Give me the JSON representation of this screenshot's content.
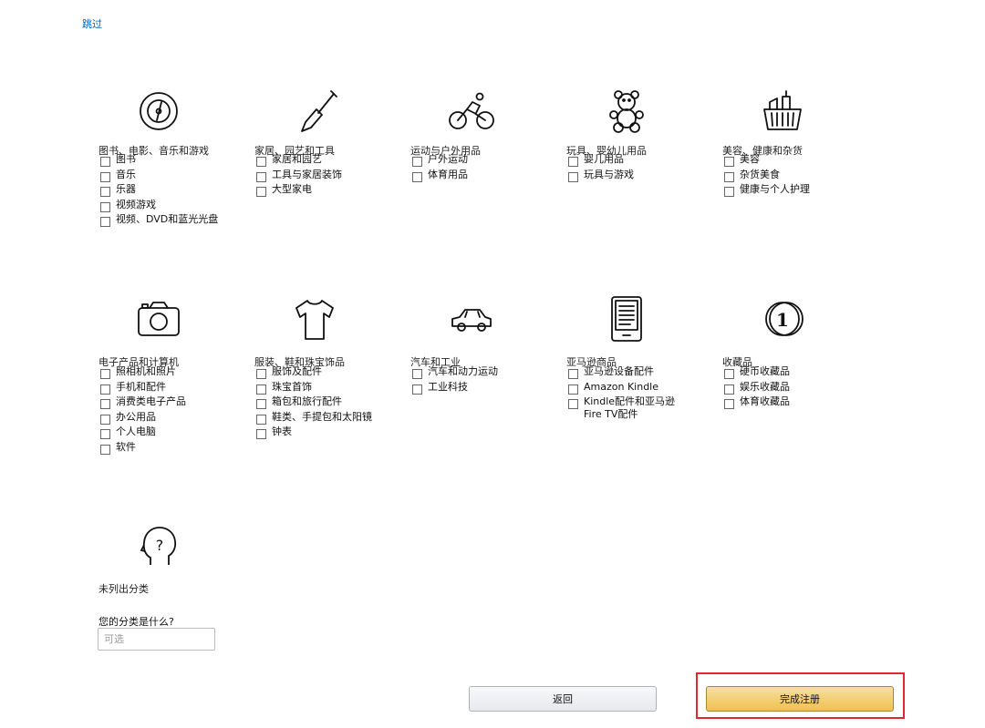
{
  "header": {
    "skip_label": "跳过"
  },
  "categories": [
    {
      "id": "books",
      "icon": "disc-icon",
      "title": "图书、电影、音乐和游戏",
      "options": [
        "图书",
        "音乐",
        "乐器",
        "视频游戏",
        "视频、DVD和蓝光光盘"
      ]
    },
    {
      "id": "home",
      "icon": "shovel-icon",
      "title": "家居、园艺和工具",
      "options": [
        "家居和园艺",
        "工具与家居装饰",
        "大型家电"
      ]
    },
    {
      "id": "sports",
      "icon": "cyclist-icon",
      "title": "运动与户外用品",
      "options": [
        "户外运动",
        "体育用品"
      ]
    },
    {
      "id": "toys",
      "icon": "teddy-bear-icon",
      "title": "玩具、婴幼儿用品",
      "options": [
        "婴儿用品",
        "玩具与游戏"
      ]
    },
    {
      "id": "beauty",
      "icon": "basket-icon",
      "title": "美容、健康和杂货",
      "options": [
        "美容",
        "杂货美食",
        "健康与个人护理"
      ]
    },
    {
      "id": "electronics",
      "icon": "camera-icon",
      "title": "电子产品和计算机",
      "options": [
        "照相机和照片",
        "手机和配件",
        "消费类电子产品",
        "办公用品",
        "个人电脑",
        "软件"
      ]
    },
    {
      "id": "fashion",
      "icon": "tshirt-icon",
      "title": "服装、鞋和珠宝饰品",
      "options": [
        "服饰及配件",
        "珠宝首饰",
        "箱包和旅行配件",
        "鞋类、手提包和太阳镜",
        "钟表"
      ]
    },
    {
      "id": "auto",
      "icon": "car-icon",
      "title": "汽车和工业",
      "options": [
        "汽车和动力运动",
        "工业科技"
      ]
    },
    {
      "id": "amazon",
      "icon": "ereader-icon",
      "title": "亚马逊商品",
      "options": [
        "亚马逊设备配件",
        "Amazon Kindle",
        "Kindle配件和亚马逊 Fire TV配件"
      ]
    },
    {
      "id": "collectibles",
      "icon": "coin-icon",
      "title": "收藏品",
      "options": [
        "硬币收藏品",
        "娱乐收藏品",
        "体育收藏品"
      ]
    }
  ],
  "unlisted": {
    "icon": "question-head-icon",
    "title": "未列出分类",
    "question": "您的分类是什么?",
    "input_placeholder": "可选",
    "input_value": ""
  },
  "actions": {
    "back_label": "返回",
    "finish_label": "完成注册"
  },
  "colors": {
    "link": "#0066c0",
    "primary_button": "#f0c14b",
    "highlight_border": "#e0282e"
  }
}
